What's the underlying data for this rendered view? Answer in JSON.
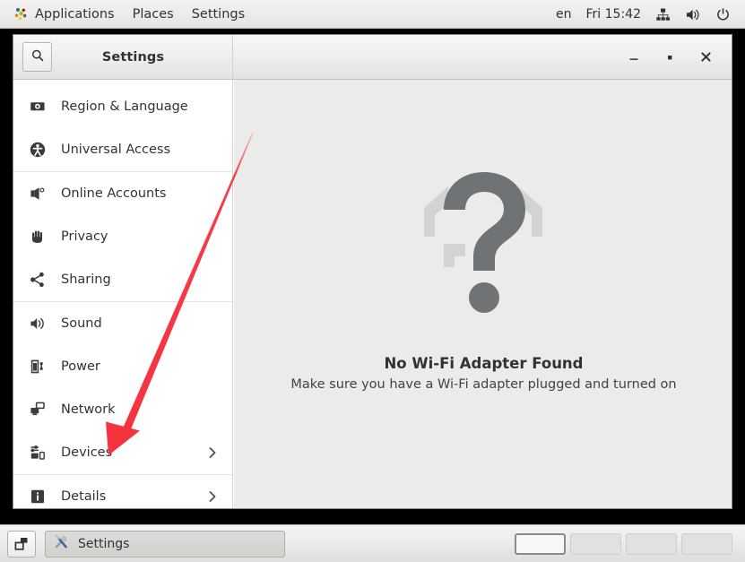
{
  "top_panel": {
    "logo_icon": "gnome-logo-icon",
    "menus": [
      {
        "label": "Applications",
        "icon": "gnome-logo-icon"
      },
      {
        "label": "Places",
        "icon": ""
      },
      {
        "label": "Settings",
        "icon": ""
      }
    ],
    "keyboard_layout": "en",
    "clock": "Fri 15:42",
    "tray_icons": [
      "network-icon",
      "volume-icon",
      "power-icon"
    ]
  },
  "window": {
    "title": "Settings",
    "search_icon": "search-icon",
    "controls": {
      "minimize": "minimize-icon",
      "maximize": "maximize-icon",
      "close": "close-icon"
    }
  },
  "sidebar": {
    "items": [
      {
        "label": "Region & Language",
        "icon": "flag-icon",
        "chevron": false,
        "separator_after": false
      },
      {
        "label": "Universal Access",
        "icon": "accessibility-icon",
        "chevron": false,
        "separator_after": true
      },
      {
        "label": "Online Accounts",
        "icon": "online-accounts-icon",
        "chevron": false,
        "separator_after": false
      },
      {
        "label": "Privacy",
        "icon": "hand-icon",
        "chevron": false,
        "separator_after": false
      },
      {
        "label": "Sharing",
        "icon": "share-icon",
        "chevron": false,
        "separator_after": true
      },
      {
        "label": "Sound",
        "icon": "speaker-icon",
        "chevron": false,
        "separator_after": false
      },
      {
        "label": "Power",
        "icon": "battery-icon",
        "chevron": false,
        "separator_after": false
      },
      {
        "label": "Network",
        "icon": "network-icon",
        "chevron": false,
        "separator_after": false
      },
      {
        "label": "Devices",
        "icon": "devices-icon",
        "chevron": true,
        "separator_after": true
      },
      {
        "label": "Details",
        "icon": "info-icon",
        "chevron": true,
        "separator_after": false
      }
    ]
  },
  "content": {
    "illustration_icon": "wifi-question-mark-icon",
    "title": "No Wi-Fi Adapter Found",
    "subtitle": "Make sure you have a Wi-Fi adapter plugged and turned on"
  },
  "annotation": {
    "arrow_color": "#f5333f",
    "arrow_points_to": "Devices"
  },
  "taskbar": {
    "show_desktop_icon": "show-desktop-icon",
    "tasks": [
      {
        "label": "Settings",
        "icon": "tools-icon",
        "active": true
      }
    ],
    "workspaces": [
      {
        "name": "1",
        "active": true
      },
      {
        "name": "2",
        "active": false
      },
      {
        "name": "3",
        "active": false
      },
      {
        "name": "4",
        "active": false
      }
    ]
  },
  "colors": {
    "panel_bg": "#ececeb",
    "window_bg": "#ffffff",
    "content_bg": "#ebebe9",
    "text": "#2e3436",
    "accent_red": "#f5333f",
    "qmark_dark": "#6f7375",
    "qmark_light": "#d2d4d4"
  }
}
